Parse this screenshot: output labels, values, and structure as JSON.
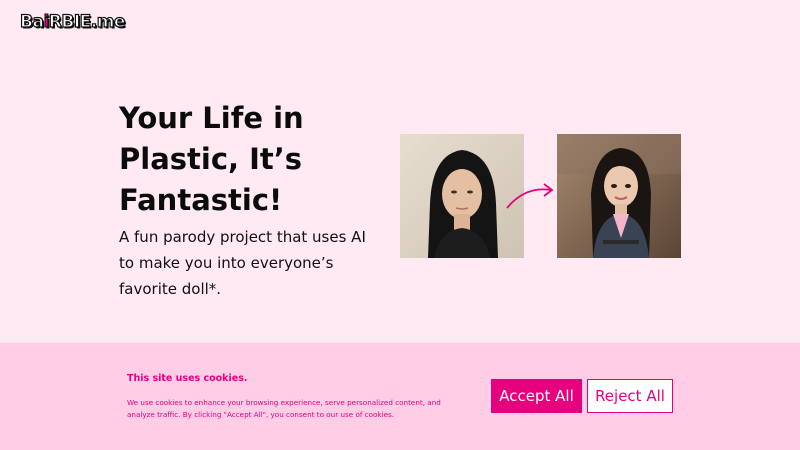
{
  "header": {
    "logo_prefix": "Ba",
    "logo_ai": "i",
    "logo_suffix": "RBIE.me"
  },
  "hero": {
    "title_line1": "Your Life in",
    "title_line2": "Plastic, It’s",
    "title_line3": "Fantastic!",
    "subtitle": "A fun parody project that uses AI to make you into everyone’s favorite doll*."
  },
  "cookie_banner": {
    "title": "This site uses cookies.",
    "text": "We use cookies to enhance your browsing experience, serve personalized content, and analyze traffic. By clicking \"Accept All\", you consent to our use of cookies.",
    "accept_label": "Accept All",
    "reject_label": "Reject All"
  },
  "colors": {
    "background": "#ffeaf4",
    "banner": "#ffcde6",
    "accent": "#e6007e"
  }
}
